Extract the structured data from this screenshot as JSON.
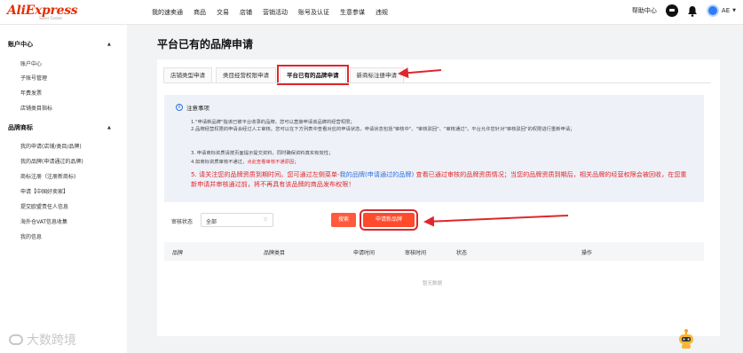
{
  "header": {
    "brand": "AliExpress",
    "brand_sub": "Seller Center",
    "nav": [
      "我的速卖通",
      "商品",
      "交易",
      "店铺",
      "营销活动",
      "账号及认证",
      "生意参谋",
      "违规"
    ],
    "help": "帮助中心",
    "user": "AE"
  },
  "sidebar": {
    "sections": [
      {
        "title": "账户中心",
        "items": [
          "账户中心",
          "子账号管理",
          "年费发票",
          "店铺类目指标"
        ]
      },
      {
        "title": "品牌商标",
        "items": [
          "我的申请(店铺/类目/品牌)",
          "我的品牌(申请通过的品牌)",
          "商标注册（注册新商标)",
          "申请【中国好卖家】",
          "提交欧盟责任人信息",
          "海外仓VAT信息收集",
          "我的信息"
        ]
      }
    ]
  },
  "watermark": "大数跨境",
  "main": {
    "title": "平台已有的品牌申请",
    "tabs": [
      {
        "label": "店铺类型申请",
        "active": false
      },
      {
        "label": "类目经营权限申请",
        "active": false
      },
      {
        "label": "平台已有的品牌申请",
        "active": true
      },
      {
        "label": "新商标注册申请",
        "active": false
      }
    ],
    "notice": {
      "title": "注意事项",
      "lines": [
        "1.\"申请新品牌\"指该已被平台收录的品牌，您可以直接申请该品牌的经营权限；",
        "2.品牌经营权限的申请会经过人工审核。您可以在下方列表中查看对应的申请状态，申请状态包括\"审核中\"、\"审核驳回\"、\"审核通过\"。平台允许您针对\"审核驳回\"的权限进行重新申请；",
        "3. 申请商标资质请按页面提示提交资料，同时确保资料真实有效性；",
        "4.如商标资质审核不通过，"
      ],
      "link": "点此查看审核不通原因",
      "line4_end": "；",
      "big_1": "5. 请关注您的品牌资质到期时间。您可通过左侧菜单-",
      "big_blue": "我的品牌(申请通过的品牌)",
      "big_2": " 查看已通过审核的品牌资质情况；当您的品牌资质到期后，相关品牌的经营权限会被回收，在您重新申请并审核通过前，将不再具有该品牌的商品发布权限！"
    },
    "filter": {
      "label": "审核状态",
      "value": "全部",
      "search_button": "搜索",
      "apply_button": "申请新品牌"
    },
    "table": {
      "columns": [
        "品牌",
        "品牌类目",
        "申请时间",
        "审核时间",
        "状态",
        "操作"
      ],
      "empty_text": "暂无数据"
    }
  },
  "colors": {
    "accent": "#ff4a2c",
    "annotation": "#e0262c",
    "link": "#2f6fe0"
  }
}
